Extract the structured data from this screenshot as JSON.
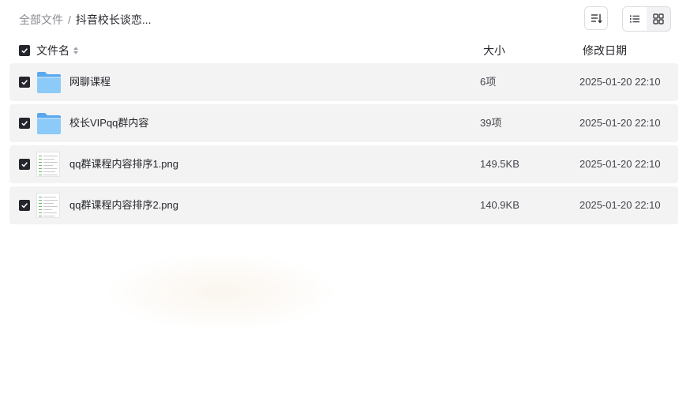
{
  "breadcrumb": {
    "root": "全部文件",
    "separator": "/",
    "current": "抖音校长谈恋..."
  },
  "toolbar": {
    "sort_icon": "sort-icon",
    "view_list_icon": "list-view-icon",
    "view_grid_icon": "grid-view-icon"
  },
  "header": {
    "name": "文件名",
    "size": "大小",
    "date": "修改日期"
  },
  "files": [
    {
      "name": "网聊课程",
      "size": "6项",
      "date": "2025-01-20 22:10",
      "type": "folder"
    },
    {
      "name": "校长VIPqq群内容",
      "size": "39项",
      "date": "2025-01-20 22:10",
      "type": "folder"
    },
    {
      "name": "qq群课程内容排序1.png",
      "size": "149.5KB",
      "date": "2025-01-20 22:10",
      "type": "image"
    },
    {
      "name": "qq群课程内容排序2.png",
      "size": "140.9KB",
      "date": "2025-01-20 22:10",
      "type": "image"
    }
  ],
  "colors": {
    "checkbox": "#25262b",
    "row_bg": "#f3f3f4",
    "folder": "#7fbff5"
  }
}
